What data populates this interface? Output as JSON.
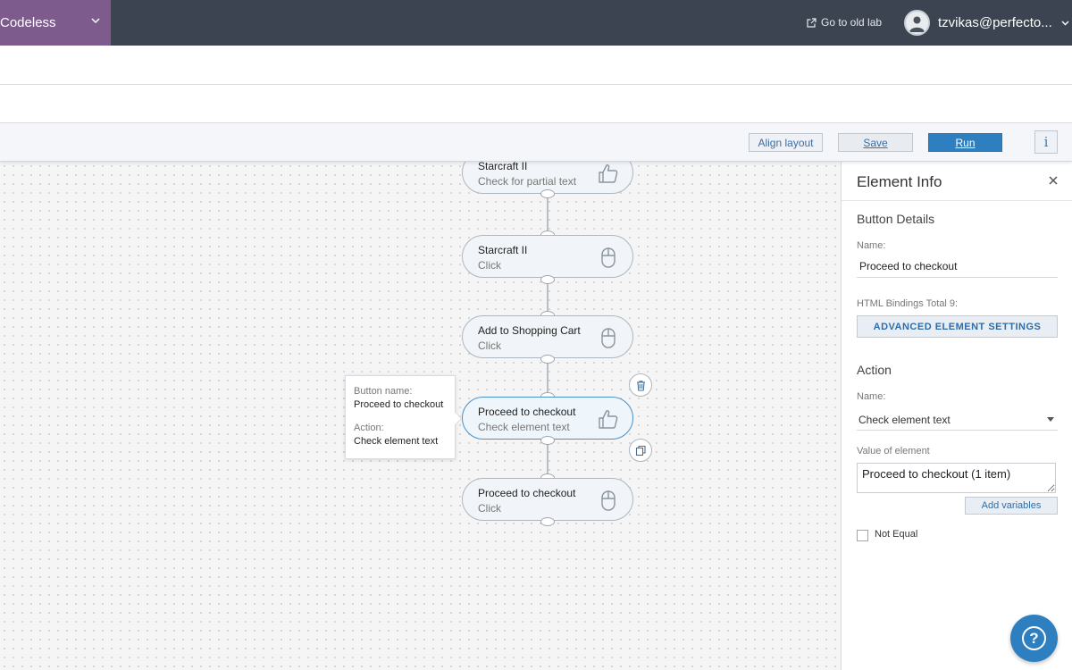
{
  "header": {
    "app_name": "Codeless",
    "old_lab_link": "Go to old lab",
    "user_name": "tzvikas@perfecto..."
  },
  "toolbar": {
    "align_label": "Align layout",
    "save_label": "Save",
    "run_label": "Run",
    "info_label": "i"
  },
  "flow": {
    "nodes": [
      {
        "title": "Starcraft II",
        "action": "Check for partial text",
        "icon": "thumbs-up-icon"
      },
      {
        "title": "Starcraft II",
        "action": "Click",
        "icon": "mouse-icon"
      },
      {
        "title": "Add to Shopping Cart",
        "action": "Click",
        "icon": "mouse-icon"
      },
      {
        "title": "Proceed to checkout",
        "action": "Check element text",
        "icon": "thumbs-up-icon"
      },
      {
        "title": "Proceed to checkout",
        "action": "Click",
        "icon": "mouse-icon"
      }
    ],
    "tooltip": {
      "button_name_label": "Button name:",
      "button_name_value": "Proceed to checkout",
      "action_label": "Action:",
      "action_value": "Check element text"
    }
  },
  "panel": {
    "title": "Element Info",
    "button_details_heading": "Button Details",
    "name_label": "Name:",
    "name_value": "Proceed to checkout",
    "bindings_label": "HTML Bindings Total 9:",
    "advanced_button": "ADVANCED ELEMENT SETTINGS",
    "action_heading": "Action",
    "action_name_label": "Name:",
    "action_name_value": "Check element text",
    "value_label": "Value of element",
    "value_text": "Proceed to checkout (1 item)",
    "add_variables_button": "Add variables",
    "not_equal_label": "Not Equal",
    "not_equal_checked": false
  },
  "colors": {
    "topbar": "#3b4450",
    "app_switch": "#7d5b8c",
    "accent": "#2e7fc0"
  }
}
